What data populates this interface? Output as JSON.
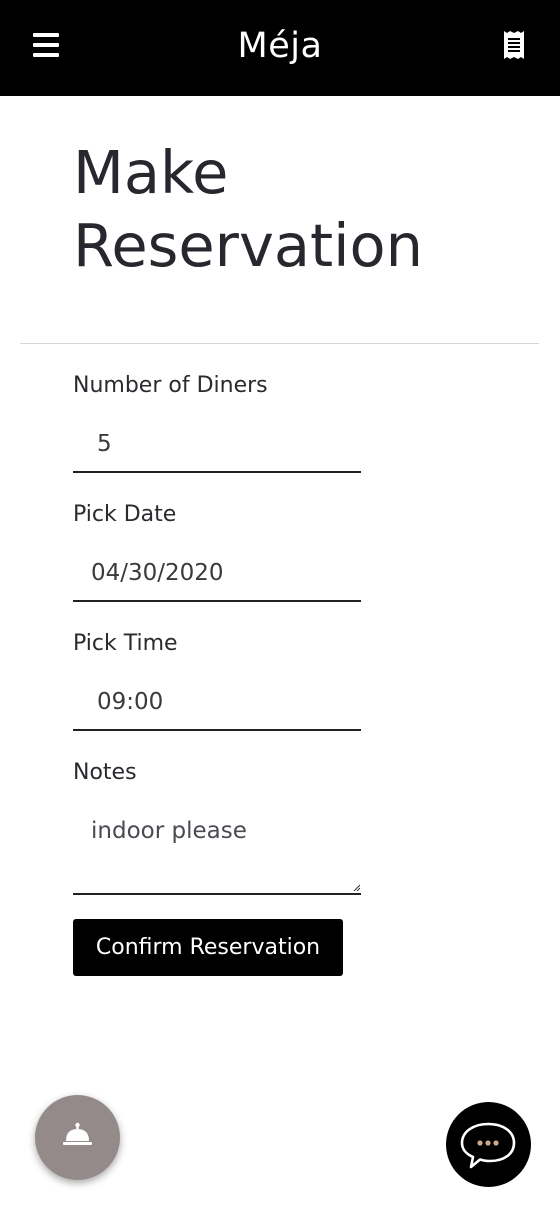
{
  "header": {
    "brand": "Méja",
    "menu_icon": "hamburger-menu-icon",
    "receipt_icon": "receipt-icon",
    "background": "#000000"
  },
  "page": {
    "title_line1": "Make",
    "title_line2": "Reservation"
  },
  "form": {
    "diners": {
      "label": "Number of Diners",
      "value": "5"
    },
    "date": {
      "label": "Pick Date",
      "value": "04/30/2020"
    },
    "time": {
      "label": "Pick Time",
      "value": "09:00"
    },
    "notes": {
      "label": "Notes",
      "value": "indoor please"
    },
    "submit_label": "Confirm Reservation"
  },
  "fabs": {
    "bell_icon": "service-bell-icon",
    "bell_color": "#958a8a",
    "chat_icon": "chat-bubble-icon",
    "chat_color": "#000000",
    "chat_dots_color": "#c9a98c"
  }
}
